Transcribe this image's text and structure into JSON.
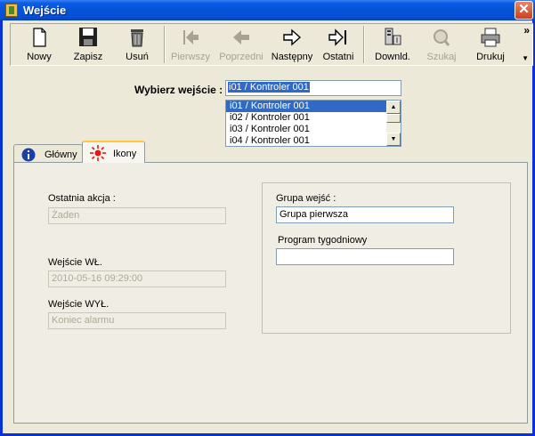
{
  "window": {
    "title": "Wejście",
    "close_glyph": "✕",
    "icon": "app-icon"
  },
  "toolbar": {
    "buttons": [
      {
        "label": "Nowy",
        "icon": "new-document-icon",
        "enabled": true
      },
      {
        "label": "Zapisz",
        "icon": "floppy-disk-icon",
        "enabled": true
      },
      {
        "label": "Usuń",
        "icon": "trash-bin-icon",
        "enabled": true
      },
      {
        "label": "Pierwszy",
        "icon": "first-record-icon",
        "enabled": false
      },
      {
        "label": "Poprzedni",
        "icon": "previous-record-icon",
        "enabled": false
      },
      {
        "label": "Następny",
        "icon": "next-record-icon",
        "enabled": true
      },
      {
        "label": "Ostatni",
        "icon": "last-record-icon",
        "enabled": true
      },
      {
        "label": "Downld.",
        "icon": "download-icon",
        "enabled": true
      },
      {
        "label": "Szukaj",
        "icon": "search-icon",
        "enabled": false
      },
      {
        "label": "Drukuj",
        "icon": "printer-icon",
        "enabled": true
      }
    ],
    "overflow_glyph": "»",
    "menu_glyph": "▼"
  },
  "selector": {
    "label": "Wybierz wejście :",
    "value": "i01 / Kontroler 001",
    "options": [
      "i01 / Kontroler 001",
      "i02 / Kontroler 001",
      "i03 / Kontroler 001",
      "i04 / Kontroler 001"
    ],
    "scroll_up_glyph": "▲",
    "scroll_down_glyph": "▼"
  },
  "tabs": [
    {
      "label": "Główny",
      "icon": "info-icon",
      "active": false
    },
    {
      "label": "Ikony",
      "icon": "alarm-light-icon",
      "active": true
    }
  ],
  "form": {
    "last_action": {
      "label": "Ostatnia akcja :",
      "value": "Żaden"
    },
    "input_on": {
      "label": "Wejście WŁ.",
      "value": "2010-05-16 09:29:00"
    },
    "input_off": {
      "label": "Wejście WYŁ.",
      "value": "Koniec alarmu"
    },
    "input_group": {
      "label": "Grupa wejść :",
      "value": "Grupa pierwsza"
    },
    "weekly_program": {
      "label": "Program tygodniowy",
      "value": ""
    }
  },
  "colors": {
    "titlebar": "#0453D8",
    "selection": "#316AC5",
    "active_tab_accent": "#FFC83C",
    "close_button": "#C7401F"
  }
}
